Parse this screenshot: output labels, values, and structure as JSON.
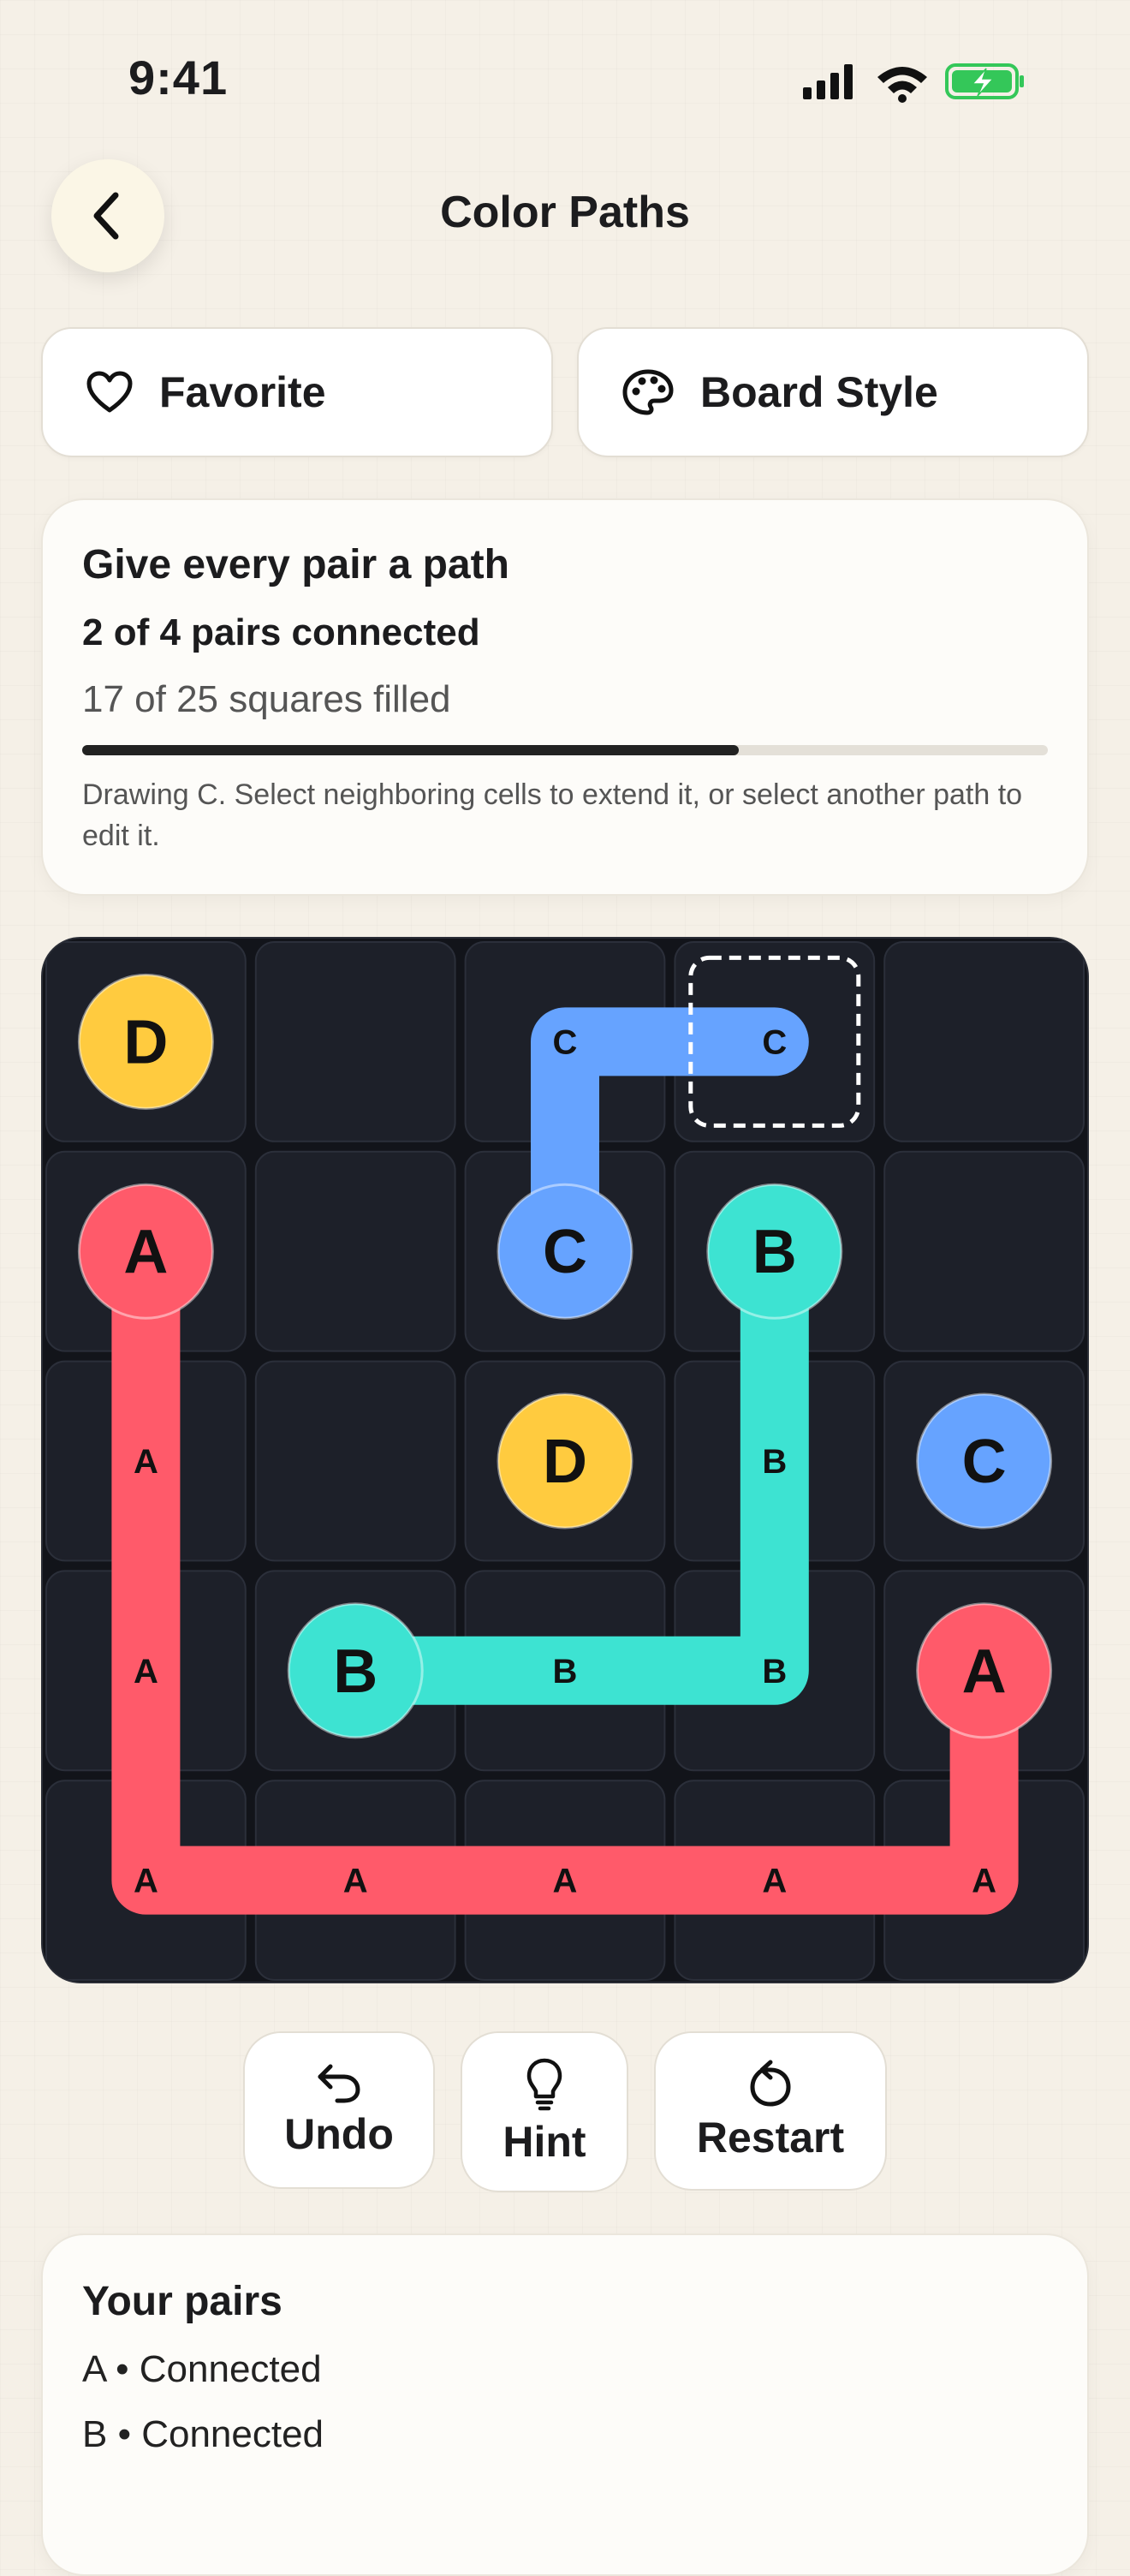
{
  "status_bar": {
    "time": "9:41"
  },
  "header": {
    "title": "Color Paths"
  },
  "actions": {
    "favorite_label": "Favorite",
    "board_style_label": "Board Style"
  },
  "status": {
    "heading": "Give every pair a path",
    "pairs_connected": "2 of 4 pairs connected",
    "squares_filled": "17 of 25 squares filled",
    "progress": 0.68,
    "hint": "Drawing C. Select neighboring cells to extend it, or select another path to edit it."
  },
  "board": {
    "size": 5,
    "colors": {
      "A": "#ff5a6a",
      "B": "#3de3d2",
      "C": "#66a3ff",
      "D": "#ffcb3f"
    },
    "endpoints": [
      {
        "letter": "D",
        "row": 0,
        "col": 0
      },
      {
        "letter": "A",
        "row": 1,
        "col": 0
      },
      {
        "letter": "C",
        "row": 1,
        "col": 2
      },
      {
        "letter": "B",
        "row": 1,
        "col": 3
      },
      {
        "letter": "D",
        "row": 2,
        "col": 2
      },
      {
        "letter": "C",
        "row": 2,
        "col": 4
      },
      {
        "letter": "B",
        "row": 3,
        "col": 1
      },
      {
        "letter": "A",
        "row": 3,
        "col": 4
      }
    ],
    "paths": [
      {
        "letter": "A",
        "cells": [
          [
            1,
            0
          ],
          [
            2,
            0
          ],
          [
            3,
            0
          ],
          [
            4,
            0
          ],
          [
            4,
            1
          ],
          [
            4,
            2
          ],
          [
            4,
            3
          ],
          [
            4,
            4
          ],
          [
            3,
            4
          ]
        ]
      },
      {
        "letter": "B",
        "cells": [
          [
            1,
            3
          ],
          [
            2,
            3
          ],
          [
            3,
            3
          ],
          [
            3,
            2
          ],
          [
            3,
            1
          ]
        ]
      },
      {
        "letter": "C",
        "cells": [
          [
            1,
            2
          ],
          [
            0,
            2
          ],
          [
            0,
            3
          ]
        ]
      }
    ],
    "selected_cell": {
      "row": 0,
      "col": 3
    }
  },
  "controls": {
    "undo_label": "Undo",
    "hint_label": "Hint",
    "restart_label": "Restart"
  },
  "pairs_panel": {
    "heading": "Your pairs",
    "items": [
      "A • Connected",
      "B • Connected"
    ]
  }
}
